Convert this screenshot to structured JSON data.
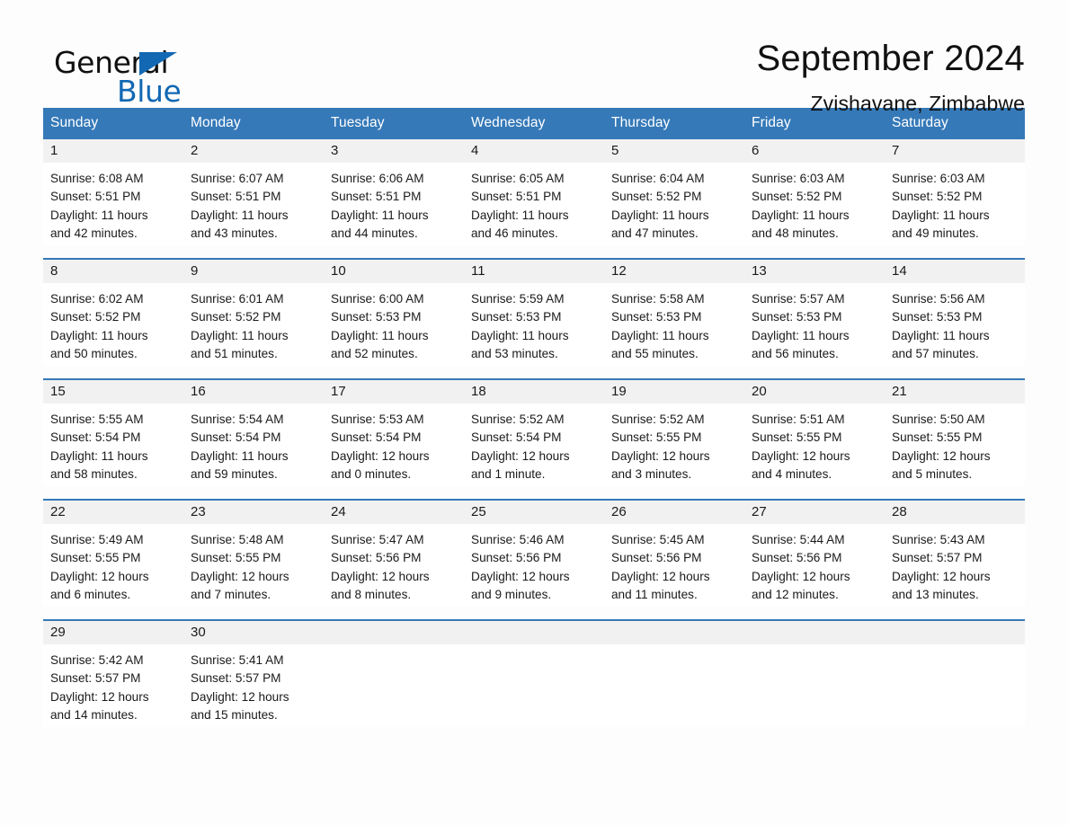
{
  "brand": {
    "word_one": "General",
    "word_two": "Blue",
    "triangle_icon": "brand-triangle-icon",
    "accent_color": "#1268b3"
  },
  "header": {
    "month_title": "September 2024",
    "location": "Zvishavane, Zimbabwe"
  },
  "calendar": {
    "header_bg": "#3579b8",
    "daynum_bg": "#f1f1f1",
    "weekday_headers": [
      "Sunday",
      "Monday",
      "Tuesday",
      "Wednesday",
      "Thursday",
      "Friday",
      "Saturday"
    ],
    "weeks": [
      [
        {
          "day": "1",
          "sunrise": "Sunrise: 6:08 AM",
          "sunset": "Sunset: 5:51 PM",
          "daylight_1": "Daylight: 11 hours",
          "daylight_2": "and 42 minutes."
        },
        {
          "day": "2",
          "sunrise": "Sunrise: 6:07 AM",
          "sunset": "Sunset: 5:51 PM",
          "daylight_1": "Daylight: 11 hours",
          "daylight_2": "and 43 minutes."
        },
        {
          "day": "3",
          "sunrise": "Sunrise: 6:06 AM",
          "sunset": "Sunset: 5:51 PM",
          "daylight_1": "Daylight: 11 hours",
          "daylight_2": "and 44 minutes."
        },
        {
          "day": "4",
          "sunrise": "Sunrise: 6:05 AM",
          "sunset": "Sunset: 5:51 PM",
          "daylight_1": "Daylight: 11 hours",
          "daylight_2": "and 46 minutes."
        },
        {
          "day": "5",
          "sunrise": "Sunrise: 6:04 AM",
          "sunset": "Sunset: 5:52 PM",
          "daylight_1": "Daylight: 11 hours",
          "daylight_2": "and 47 minutes."
        },
        {
          "day": "6",
          "sunrise": "Sunrise: 6:03 AM",
          "sunset": "Sunset: 5:52 PM",
          "daylight_1": "Daylight: 11 hours",
          "daylight_2": "and 48 minutes."
        },
        {
          "day": "7",
          "sunrise": "Sunrise: 6:03 AM",
          "sunset": "Sunset: 5:52 PM",
          "daylight_1": "Daylight: 11 hours",
          "daylight_2": "and 49 minutes."
        }
      ],
      [
        {
          "day": "8",
          "sunrise": "Sunrise: 6:02 AM",
          "sunset": "Sunset: 5:52 PM",
          "daylight_1": "Daylight: 11 hours",
          "daylight_2": "and 50 minutes."
        },
        {
          "day": "9",
          "sunrise": "Sunrise: 6:01 AM",
          "sunset": "Sunset: 5:52 PM",
          "daylight_1": "Daylight: 11 hours",
          "daylight_2": "and 51 minutes."
        },
        {
          "day": "10",
          "sunrise": "Sunrise: 6:00 AM",
          "sunset": "Sunset: 5:53 PM",
          "daylight_1": "Daylight: 11 hours",
          "daylight_2": "and 52 minutes."
        },
        {
          "day": "11",
          "sunrise": "Sunrise: 5:59 AM",
          "sunset": "Sunset: 5:53 PM",
          "daylight_1": "Daylight: 11 hours",
          "daylight_2": "and 53 minutes."
        },
        {
          "day": "12",
          "sunrise": "Sunrise: 5:58 AM",
          "sunset": "Sunset: 5:53 PM",
          "daylight_1": "Daylight: 11 hours",
          "daylight_2": "and 55 minutes."
        },
        {
          "day": "13",
          "sunrise": "Sunrise: 5:57 AM",
          "sunset": "Sunset: 5:53 PM",
          "daylight_1": "Daylight: 11 hours",
          "daylight_2": "and 56 minutes."
        },
        {
          "day": "14",
          "sunrise": "Sunrise: 5:56 AM",
          "sunset": "Sunset: 5:53 PM",
          "daylight_1": "Daylight: 11 hours",
          "daylight_2": "and 57 minutes."
        }
      ],
      [
        {
          "day": "15",
          "sunrise": "Sunrise: 5:55 AM",
          "sunset": "Sunset: 5:54 PM",
          "daylight_1": "Daylight: 11 hours",
          "daylight_2": "and 58 minutes."
        },
        {
          "day": "16",
          "sunrise": "Sunrise: 5:54 AM",
          "sunset": "Sunset: 5:54 PM",
          "daylight_1": "Daylight: 11 hours",
          "daylight_2": "and 59 minutes."
        },
        {
          "day": "17",
          "sunrise": "Sunrise: 5:53 AM",
          "sunset": "Sunset: 5:54 PM",
          "daylight_1": "Daylight: 12 hours",
          "daylight_2": "and 0 minutes."
        },
        {
          "day": "18",
          "sunrise": "Sunrise: 5:52 AM",
          "sunset": "Sunset: 5:54 PM",
          "daylight_1": "Daylight: 12 hours",
          "daylight_2": "and 1 minute."
        },
        {
          "day": "19",
          "sunrise": "Sunrise: 5:52 AM",
          "sunset": "Sunset: 5:55 PM",
          "daylight_1": "Daylight: 12 hours",
          "daylight_2": "and 3 minutes."
        },
        {
          "day": "20",
          "sunrise": "Sunrise: 5:51 AM",
          "sunset": "Sunset: 5:55 PM",
          "daylight_1": "Daylight: 12 hours",
          "daylight_2": "and 4 minutes."
        },
        {
          "day": "21",
          "sunrise": "Sunrise: 5:50 AM",
          "sunset": "Sunset: 5:55 PM",
          "daylight_1": "Daylight: 12 hours",
          "daylight_2": "and 5 minutes."
        }
      ],
      [
        {
          "day": "22",
          "sunrise": "Sunrise: 5:49 AM",
          "sunset": "Sunset: 5:55 PM",
          "daylight_1": "Daylight: 12 hours",
          "daylight_2": "and 6 minutes."
        },
        {
          "day": "23",
          "sunrise": "Sunrise: 5:48 AM",
          "sunset": "Sunset: 5:55 PM",
          "daylight_1": "Daylight: 12 hours",
          "daylight_2": "and 7 minutes."
        },
        {
          "day": "24",
          "sunrise": "Sunrise: 5:47 AM",
          "sunset": "Sunset: 5:56 PM",
          "daylight_1": "Daylight: 12 hours",
          "daylight_2": "and 8 minutes."
        },
        {
          "day": "25",
          "sunrise": "Sunrise: 5:46 AM",
          "sunset": "Sunset: 5:56 PM",
          "daylight_1": "Daylight: 12 hours",
          "daylight_2": "and 9 minutes."
        },
        {
          "day": "26",
          "sunrise": "Sunrise: 5:45 AM",
          "sunset": "Sunset: 5:56 PM",
          "daylight_1": "Daylight: 12 hours",
          "daylight_2": "and 11 minutes."
        },
        {
          "day": "27",
          "sunrise": "Sunrise: 5:44 AM",
          "sunset": "Sunset: 5:56 PM",
          "daylight_1": "Daylight: 12 hours",
          "daylight_2": "and 12 minutes."
        },
        {
          "day": "28",
          "sunrise": "Sunrise: 5:43 AM",
          "sunset": "Sunset: 5:57 PM",
          "daylight_1": "Daylight: 12 hours",
          "daylight_2": "and 13 minutes."
        }
      ],
      [
        {
          "day": "29",
          "sunrise": "Sunrise: 5:42 AM",
          "sunset": "Sunset: 5:57 PM",
          "daylight_1": "Daylight: 12 hours",
          "daylight_2": "and 14 minutes."
        },
        {
          "day": "30",
          "sunrise": "Sunrise: 5:41 AM",
          "sunset": "Sunset: 5:57 PM",
          "daylight_1": "Daylight: 12 hours",
          "daylight_2": "and 15 minutes."
        },
        {
          "day": "",
          "sunrise": "",
          "sunset": "",
          "daylight_1": "",
          "daylight_2": ""
        },
        {
          "day": "",
          "sunrise": "",
          "sunset": "",
          "daylight_1": "",
          "daylight_2": ""
        },
        {
          "day": "",
          "sunrise": "",
          "sunset": "",
          "daylight_1": "",
          "daylight_2": ""
        },
        {
          "day": "",
          "sunrise": "",
          "sunset": "",
          "daylight_1": "",
          "daylight_2": ""
        },
        {
          "day": "",
          "sunrise": "",
          "sunset": "",
          "daylight_1": "",
          "daylight_2": ""
        }
      ]
    ]
  }
}
